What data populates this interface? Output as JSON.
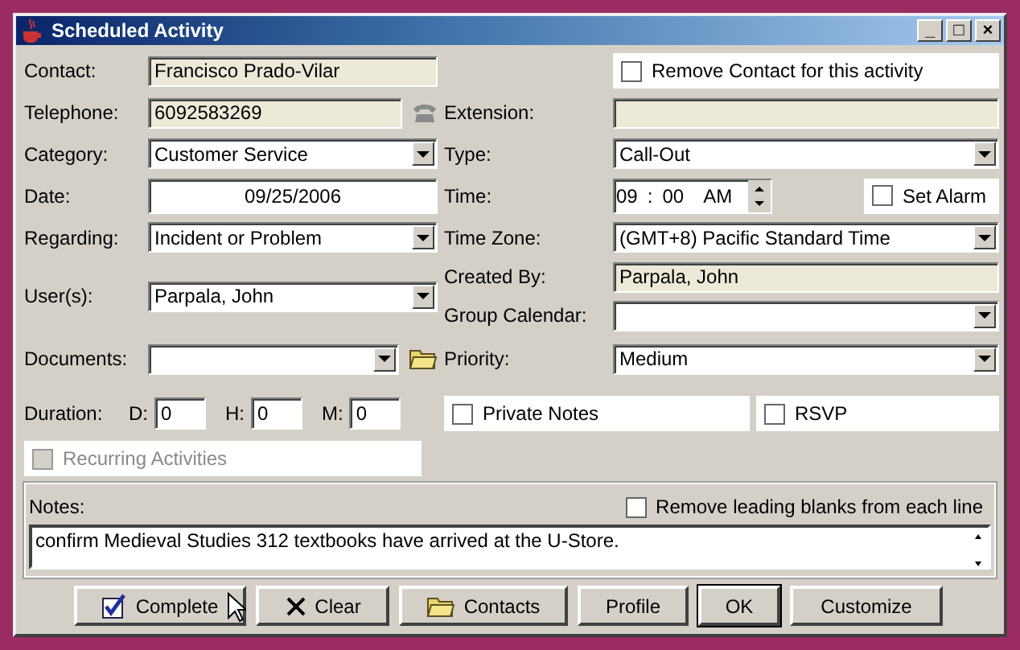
{
  "window": {
    "title": "Scheduled Activity",
    "controls": [
      "_",
      "□",
      "×"
    ]
  },
  "fields": [
    {
      "kind": "text",
      "label": "Contact:",
      "value": "Francisco Prado-Vilar",
      "readonly": true
    },
    {
      "kind": "check",
      "label": "Remove Contact for this activity",
      "checked": false
    },
    {
      "kind": "text",
      "label": "Telephone:",
      "value": "6092583269",
      "readonly": true
    },
    {
      "kind": "text",
      "label": "Extension:",
      "readonly": true
    },
    {
      "kind": "combo",
      "label": "Category:",
      "value": "Customer Service"
    },
    {
      "kind": "combo",
      "label": "Type:",
      "value": "Call-Out"
    },
    {
      "kind": "date",
      "label": "Date:",
      "value": "09/25/2006"
    },
    {
      "kind": "time",
      "label": "Time:",
      "hour": "09",
      "sep": ":",
      "minute": "00",
      "ampm": "AM",
      "alarm": {
        "label": "Set Alarm",
        "checked": false
      }
    },
    {
      "kind": "combo",
      "label": "Regarding:",
      "value": "Incident or Problem"
    },
    {
      "kind": "combo",
      "label": "Time Zone:",
      "value": "(GMT+8) Pacific Standard Time"
    },
    {
      "kind": "text",
      "label": "Created By:",
      "value": "Parpala, John",
      "readonly": true
    },
    {
      "kind": "combo",
      "label": "User(s):",
      "value": "Parpala, John"
    },
    {
      "kind": "combo",
      "label": "Group Calendar:"
    },
    {
      "kind": "combo",
      "label": "Documents:"
    },
    {
      "kind": "combo",
      "label": "Priority:",
      "value": "Medium"
    }
  ],
  "duration": {
    "label": "Duration:",
    "parts": [
      {
        "label": "D:",
        "value": "0"
      },
      {
        "label": "H:",
        "value": "0"
      },
      {
        "label": "M:",
        "value": "0"
      }
    ]
  },
  "options": [
    {
      "label": "Private Notes",
      "checked": false
    },
    {
      "label": "RSVP",
      "checked": false
    }
  ],
  "recurring": {
    "label": "Recurring Activities",
    "checked": false,
    "disabled": true
  },
  "notes": {
    "label": "Notes:",
    "remove_blanks": {
      "label": "Remove leading blanks from each line",
      "checked": false
    },
    "value": "confirm Medieval Studies 312 textbooks have arrived at the U-Store."
  },
  "buttons": [
    {
      "label": "Complete"
    },
    {
      "label": "Clear"
    },
    {
      "label": "Contacts"
    },
    {
      "label": "Profile"
    },
    {
      "label": "OK",
      "default": true
    },
    {
      "label": "Customize"
    }
  ]
}
